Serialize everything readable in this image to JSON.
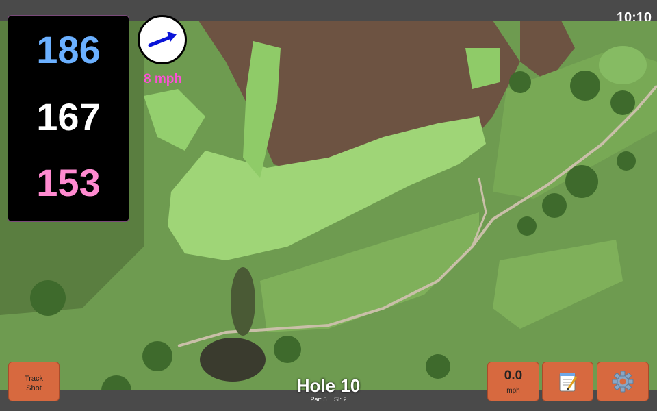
{
  "status_bar": {
    "time": "10:10"
  },
  "distances": {
    "back": "186",
    "center": "167",
    "front": "153"
  },
  "wind": {
    "speed_label": "8 mph"
  },
  "buttons": {
    "track_shot_line1": "Track",
    "track_shot_line2": "Shot",
    "wind_value": "0.0",
    "wind_unit": "mph",
    "notes_icon": "notepad-icon",
    "settings_icon": "gear-icon"
  },
  "hole": {
    "title": "Hole 10",
    "par": "Par: 5",
    "si": "SI: 2"
  },
  "colors": {
    "back": "#6bb0ff",
    "center": "#ffffff",
    "front": "#ff8ad0",
    "wind_speed": "#ff4fd8",
    "button": "#d7693f"
  }
}
